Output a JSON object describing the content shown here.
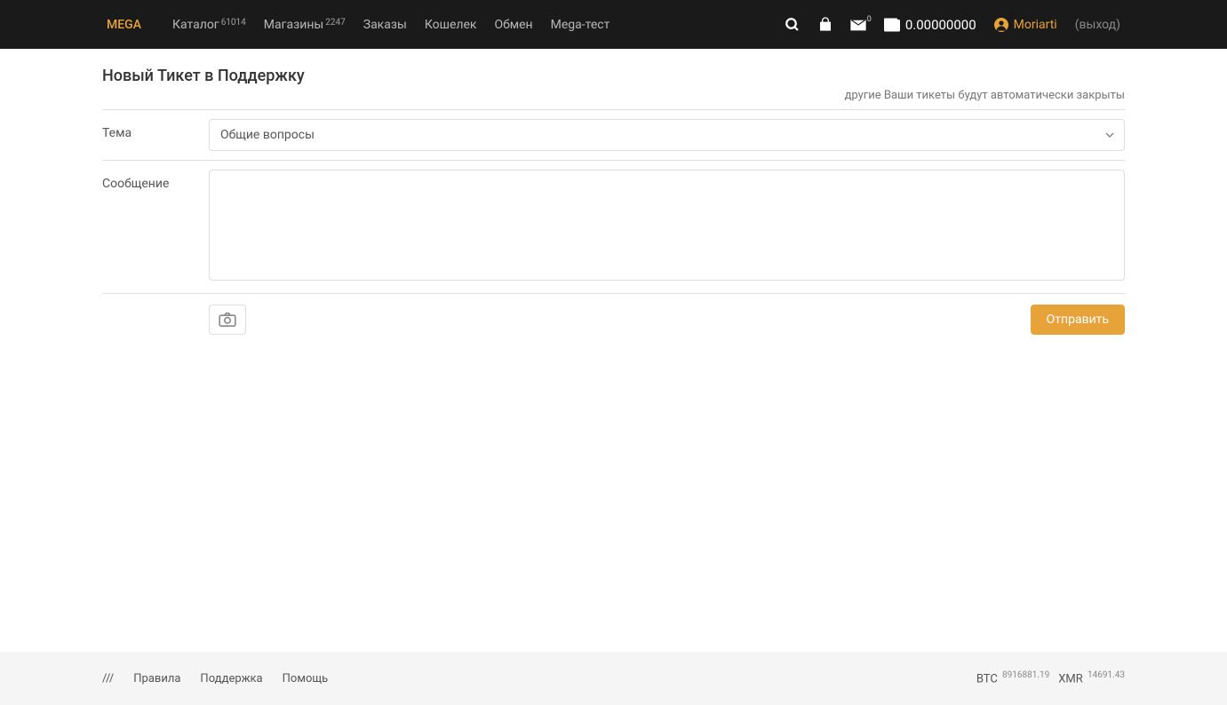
{
  "header": {
    "logo": "MEGA",
    "nav": {
      "catalog": {
        "label": "Каталог",
        "count": "61014"
      },
      "shops": {
        "label": "Магазины",
        "count": "2247"
      },
      "orders": {
        "label": "Заказы"
      },
      "wallet": {
        "label": "Кошелек"
      },
      "exchange": {
        "label": "Обмен"
      },
      "megatest": {
        "label": "Mega-тест"
      }
    },
    "mail_badge": "0",
    "balance": "0.00000000",
    "username": "Moriarti",
    "logout": "(выход)"
  },
  "page": {
    "title": "Новый Тикет в Поддержку",
    "subtitle": "другие Ваши тикеты будут автоматически закрыты"
  },
  "form": {
    "topic_label": "Тема",
    "topic_value": "Общие вопросы",
    "message_label": "Сообщение",
    "message_value": "",
    "submit_label": "Отправить"
  },
  "footer": {
    "links": {
      "slash": "///",
      "rules": "Правила",
      "support": "Поддержка",
      "help": "Помощь"
    },
    "rates": {
      "btc_label": "BTC",
      "btc_value": "8916881.19",
      "xmr_label": "XMR",
      "xmr_value": "14691.43"
    }
  }
}
